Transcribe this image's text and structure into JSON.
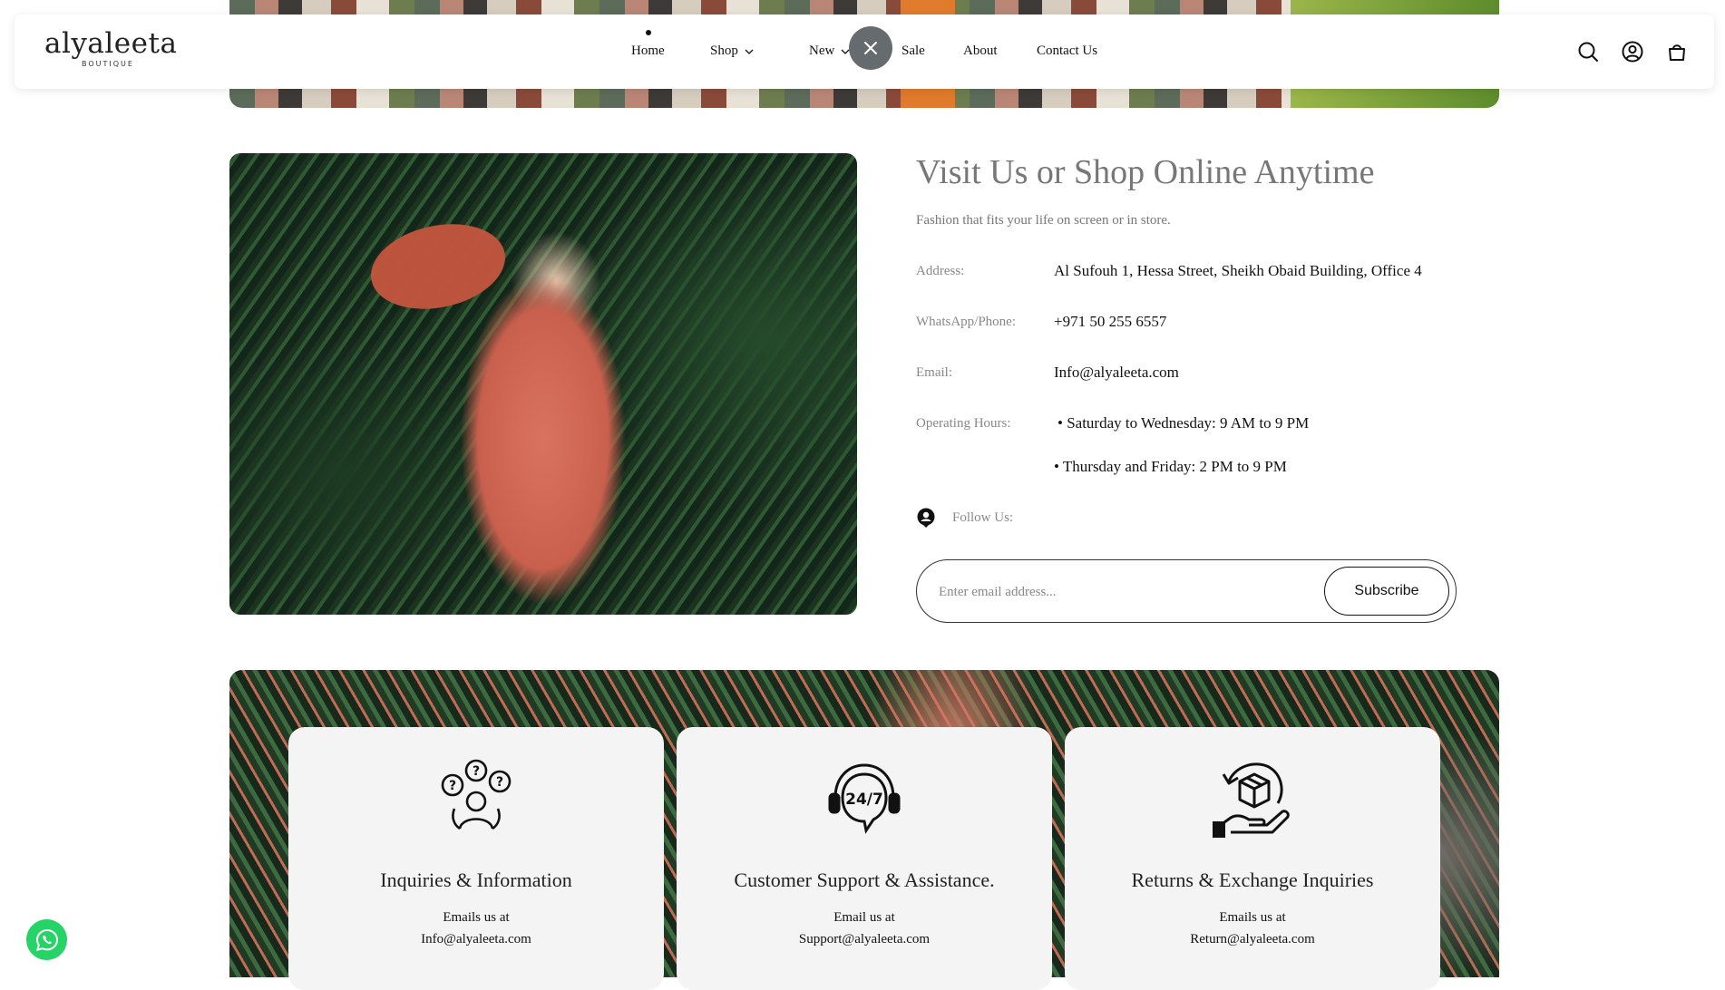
{
  "brand": {
    "logo_word": "alyaleeta",
    "logo_sub": "BOUTIQUE"
  },
  "nav": {
    "items": [
      {
        "label": "Home",
        "active": true
      },
      {
        "label": "Shop",
        "dropdown": true
      },
      {
        "label": "New",
        "dropdown": true
      },
      {
        "label": "Sale"
      },
      {
        "label": "About"
      },
      {
        "label": "Contact Us"
      }
    ]
  },
  "header_icons": [
    "search-icon",
    "account-icon",
    "cart-icon"
  ],
  "visit": {
    "title": "Visit Us or Shop Online Anytime",
    "subtitle": "Fashion that fits your life on screen or in store.",
    "address_label": "Address:",
    "address_value": "Al Sufouh 1, Hessa Street, Sheikh Obaid Building, Office 4",
    "phone_label": "WhatsApp/Phone:",
    "phone_value": "+971 50 255 6557",
    "email_label": "Email:",
    "email_value": "Info@alyaleeta.com",
    "hours_label": "Operating Hours:",
    "hours_1": "• Saturday to Wednesday: 9 AM to 9 PM",
    "hours_2": "• Thursday and Friday: 2 PM to 9 PM",
    "follow_label": "Follow Us:"
  },
  "newsletter": {
    "placeholder": "Enter email address...",
    "button_label": "Subscribe"
  },
  "support_cards": [
    {
      "icon": "inquiries-icon",
      "title": "Inquiries & Information",
      "line1": "Emails us at",
      "line2": "Info@alyaleeta.com"
    },
    {
      "icon": "support-24-7-icon",
      "title": "Customer Support & Assistance.",
      "line1": "Email us at",
      "line2": "Support@alyaleeta.com"
    },
    {
      "icon": "returns-icon",
      "title": "Returns & Exchange Inquiries",
      "line1": "Emails us at",
      "line2": "Return@alyaleeta.com"
    }
  ],
  "colors": {
    "whatsapp": "#25d366",
    "close_button": "#666b70",
    "card_bg": "#f4f4f4"
  }
}
